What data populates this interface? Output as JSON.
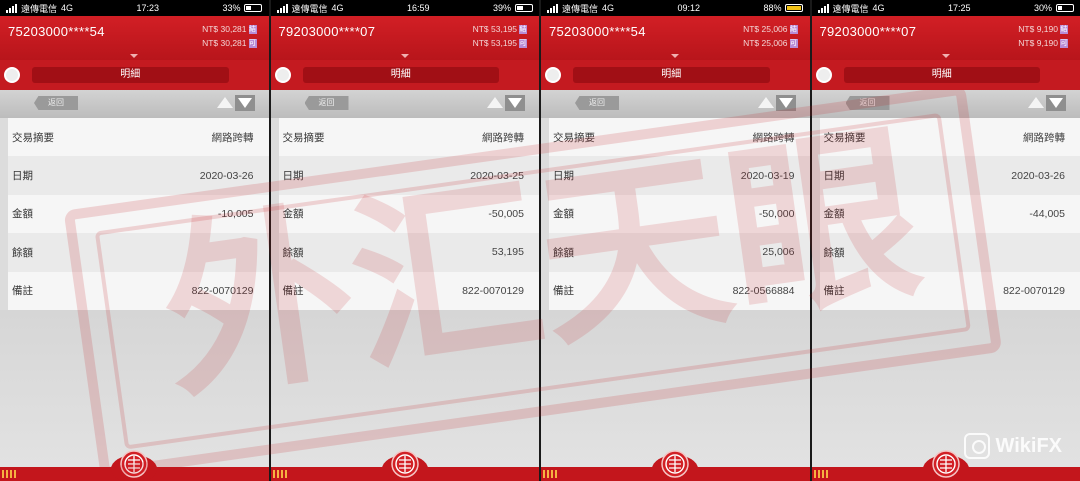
{
  "screens": [
    {
      "status": {
        "carrier": "遠傳電信",
        "network": "4G",
        "time": "17:23",
        "battery": "33%"
      },
      "account": "75203000****54",
      "balance1": "NT$ 30,281",
      "balance1_tag": "結",
      "balance2": "NT$ 30,281",
      "balance2_tag": "可",
      "tab_label": "明細",
      "back_label": "返回",
      "rows": [
        {
          "label": "交易摘要",
          "value": "網路跨轉"
        },
        {
          "label": "日期",
          "value": "2020-03-26"
        },
        {
          "label": "金額",
          "value": "-10,005"
        },
        {
          "label": "餘額",
          "value": ""
        },
        {
          "label": "備註",
          "value": "822-0070129"
        }
      ]
    },
    {
      "status": {
        "carrier": "遠傳電信",
        "network": "4G",
        "time": "16:59",
        "battery": "39%"
      },
      "account": "79203000****07",
      "balance1": "NT$ 53,195",
      "balance1_tag": "結",
      "balance2": "NT$ 53,195",
      "balance2_tag": "可",
      "tab_label": "明細",
      "back_label": "返回",
      "rows": [
        {
          "label": "交易摘要",
          "value": "網路跨轉"
        },
        {
          "label": "日期",
          "value": "2020-03-25"
        },
        {
          "label": "金額",
          "value": "-50,005"
        },
        {
          "label": "餘額",
          "value": "53,195"
        },
        {
          "label": "備註",
          "value": "822-0070129"
        }
      ]
    },
    {
      "status": {
        "carrier": "遠傳電信",
        "network": "4G",
        "time": "09:12",
        "battery": "88%"
      },
      "account": "75203000****54",
      "balance1": "NT$ 25,006",
      "balance1_tag": "結",
      "balance2": "NT$ 25,006",
      "balance2_tag": "可",
      "tab_label": "明細",
      "back_label": "返回",
      "rows": [
        {
          "label": "交易摘要",
          "value": "網路跨轉"
        },
        {
          "label": "日期",
          "value": "2020-03-19"
        },
        {
          "label": "金額",
          "value": "-50,000"
        },
        {
          "label": "餘額",
          "value": "25,006"
        },
        {
          "label": "備註",
          "value": "822-0566884"
        }
      ]
    },
    {
      "status": {
        "carrier": "遠傳電信",
        "network": "4G",
        "time": "17:25",
        "battery": "30%"
      },
      "account": "79203000****07",
      "balance1": "NT$ 9,190",
      "balance1_tag": "結",
      "balance2": "NT$ 9,190",
      "balance2_tag": "可",
      "tab_label": "明細",
      "back_label": "返回",
      "rows": [
        {
          "label": "交易摘要",
          "value": "網路跨轉"
        },
        {
          "label": "日期",
          "value": "2020-03-26"
        },
        {
          "label": "金額",
          "value": "-44,005"
        },
        {
          "label": "餘額",
          "value": ""
        },
        {
          "label": "備註",
          "value": "822-0070129"
        }
      ]
    }
  ],
  "watermark": {
    "stamp_text": "外汇天眼",
    "brand": "WikiFX"
  },
  "colors": {
    "bank_red": "#c41a20",
    "header_red": "#d21f25",
    "background_gray": "#d9d9d9"
  },
  "icons": {
    "knob": "circle-knob-icon",
    "prev": "arrow-up-icon",
    "next": "arrow-down-icon",
    "back": "back-arrow-icon",
    "logo": "bank-logo-icon"
  }
}
